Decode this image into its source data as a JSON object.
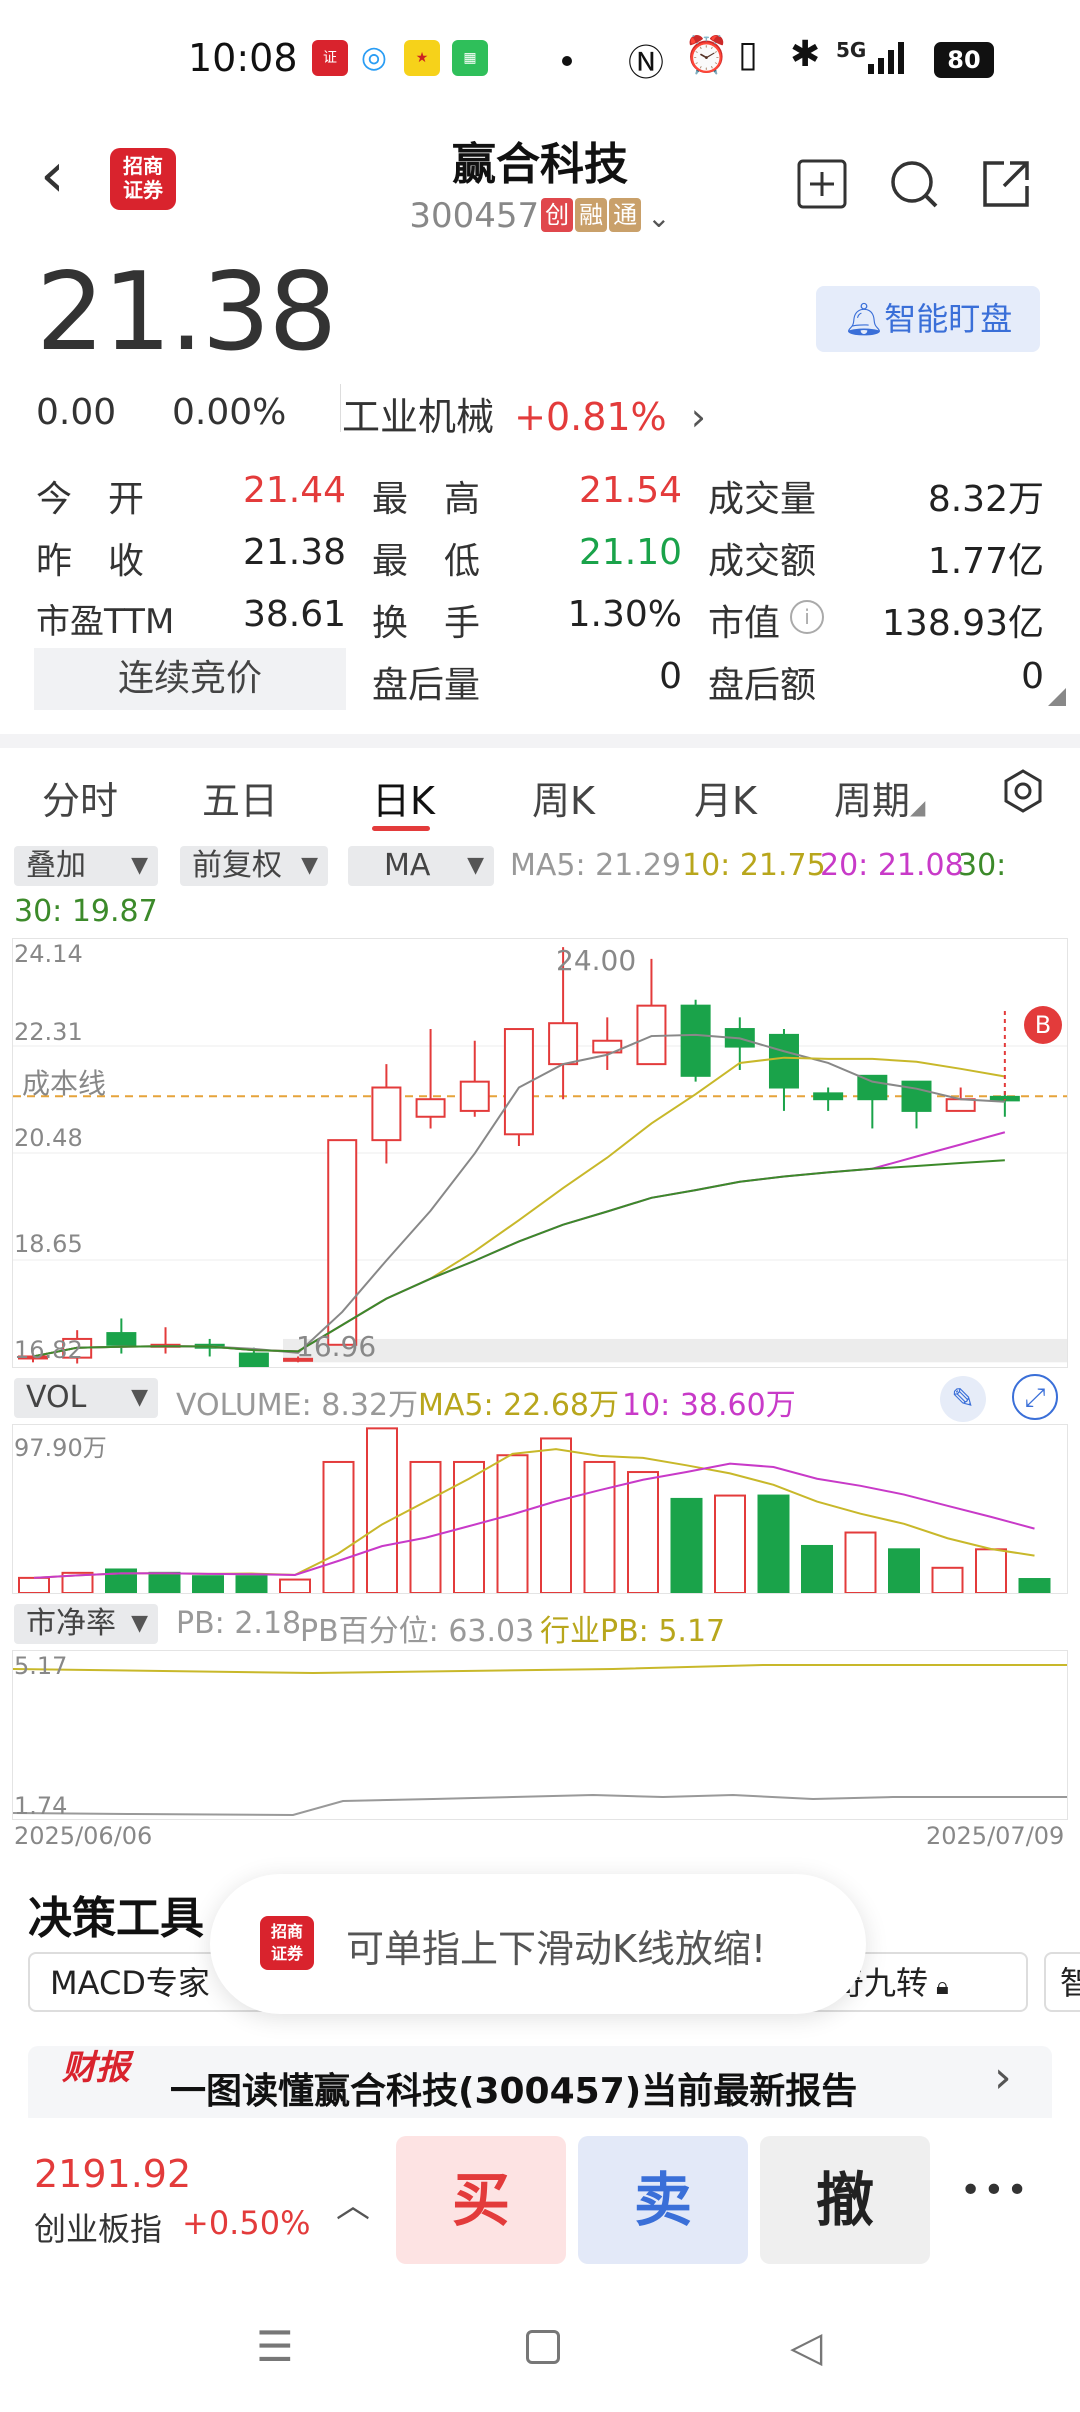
{
  "status_bar": {
    "time": "10:08",
    "battery": "80",
    "network": "5G"
  },
  "header": {
    "title": "赢合科技",
    "code": "300457",
    "tags": [
      {
        "text": "创",
        "color": "#e0474c"
      },
      {
        "text": "融",
        "color": "#c9a06a"
      },
      {
        "text": "通",
        "color": "#c9a06a"
      }
    ],
    "logo_line1": "招商",
    "logo_line2": "证券"
  },
  "quote": {
    "price": "21.38",
    "change": "0.00",
    "change_pct": "0.00%",
    "industry": "工业机械",
    "industry_pct": "+0.81%",
    "watch_button": "智能盯盘"
  },
  "stats": [
    {
      "label": "今　开",
      "value": "21.44",
      "color": "red"
    },
    {
      "label": "最　高",
      "value": "21.54",
      "color": "red"
    },
    {
      "label": "成交量",
      "value": "8.32万",
      "color": "plain"
    },
    {
      "label": "昨　收",
      "value": "21.38",
      "color": "plain"
    },
    {
      "label": "最　低",
      "value": "21.10",
      "color": "green"
    },
    {
      "label": "成交额",
      "value": "1.77亿",
      "color": "plain"
    },
    {
      "label": "市盈TTM",
      "value": "38.61",
      "color": "plain"
    },
    {
      "label": "换　手",
      "value": "1.30%",
      "color": "plain"
    },
    {
      "label": "市值",
      "value": "138.93亿",
      "color": "plain"
    },
    {
      "label": "盘后量",
      "value": "0",
      "color": "plain"
    },
    {
      "label": "盘后额",
      "value": "0",
      "color": "plain"
    }
  ],
  "auction_button": "连续竞价",
  "tabs": [
    "分时",
    "五日",
    "日K",
    "周K",
    "月K",
    "周期"
  ],
  "active_tab": "日K",
  "toolbar": {
    "overlay": "叠加",
    "adjust": "前复权",
    "indicator": "MA"
  },
  "ma_legend": {
    "ma5": "MA5: 21.29",
    "ma10": "10: 21.75",
    "ma20": "20: 21.08",
    "ma30": "30: 19.87"
  },
  "price_axis": [
    "24.14",
    "22.31",
    "20.48",
    "18.65",
    "16.82"
  ],
  "cost_line_label": "成本线",
  "high_annotation": "24.00",
  "low_annotation": "16.96",
  "buy_marker": "B",
  "volume_legend": {
    "selector": "VOL",
    "volume": "VOLUME: 8.32万",
    "ma5": "MA5: 22.68万",
    "ma10": "10: 38.60万"
  },
  "volume_axis": "97.90万",
  "pb_legend": {
    "selector": "市净率",
    "pb": "PB: 2.18",
    "pb_pct": "PB百分位: 63.03",
    "industry_pb": "行业PB: 5.17"
  },
  "pb_axis": [
    "5.17",
    "1.74"
  ],
  "dates": {
    "start": "2025/06/06",
    "end": "2025/07/09"
  },
  "colors": {
    "up": "#e33b3b",
    "down": "#1aa34a",
    "ma5": "#888888",
    "ma10": "#c8b82a",
    "ma20": "#c83ac8",
    "ma30": "#3c8a2a"
  },
  "chart_data": {
    "type": "candlestick",
    "candles": [
      {
        "o": 17.0,
        "c": 17.0,
        "h": 17.05,
        "l": 16.9
      },
      {
        "o": 16.98,
        "c": 17.3,
        "h": 17.45,
        "l": 16.88
      },
      {
        "o": 17.4,
        "c": 17.2,
        "h": 17.65,
        "l": 17.05
      },
      {
        "o": 17.2,
        "c": 17.2,
        "h": 17.5,
        "l": 17.05
      },
      {
        "o": 17.2,
        "c": 17.15,
        "h": 17.3,
        "l": 17.0
      },
      {
        "o": 17.05,
        "c": 16.8,
        "h": 17.15,
        "l": 16.75
      },
      {
        "o": 16.96,
        "c": 16.96,
        "h": 17.0,
        "l": 16.9
      },
      {
        "o": 17.2,
        "c": 20.7,
        "h": 20.7,
        "l": 17.2
      },
      {
        "o": 20.7,
        "c": 21.6,
        "h": 22.0,
        "l": 20.3
      },
      {
        "o": 21.1,
        "c": 21.4,
        "h": 22.6,
        "l": 20.9
      },
      {
        "o": 21.2,
        "c": 21.7,
        "h": 22.4,
        "l": 21.1
      },
      {
        "o": 20.8,
        "c": 22.6,
        "h": 22.6,
        "l": 20.6
      },
      {
        "o": 22.0,
        "c": 22.7,
        "h": 24.0,
        "l": 21.4
      },
      {
        "o": 22.2,
        "c": 22.4,
        "h": 22.8,
        "l": 21.9
      },
      {
        "o": 22.0,
        "c": 23.0,
        "h": 23.8,
        "l": 22.0
      },
      {
        "o": 23.0,
        "c": 21.8,
        "h": 23.1,
        "l": 21.7
      },
      {
        "o": 22.6,
        "c": 22.3,
        "h": 22.8,
        "l": 21.9
      },
      {
        "o": 22.5,
        "c": 21.6,
        "h": 22.6,
        "l": 21.2
      },
      {
        "o": 21.5,
        "c": 21.4,
        "h": 21.6,
        "l": 21.2
      },
      {
        "o": 21.8,
        "c": 21.4,
        "h": 21.8,
        "l": 20.9
      },
      {
        "o": 21.7,
        "c": 21.2,
        "h": 21.7,
        "l": 20.9
      },
      {
        "o": 21.2,
        "c": 21.4,
        "h": 21.6,
        "l": 21.2
      },
      {
        "o": 21.44,
        "c": 21.38,
        "h": 21.54,
        "l": 21.1
      }
    ],
    "volume": [
      9,
      12,
      14,
      12,
      10,
      10,
      8,
      78,
      98,
      78,
      78,
      82,
      92,
      78,
      72,
      56,
      58,
      58,
      28,
      36,
      26,
      15,
      26,
      8.32
    ],
    "volume_up": [
      true,
      true,
      false,
      false,
      false,
      false,
      true,
      true,
      true,
      true,
      true,
      true,
      true,
      true,
      true,
      false,
      true,
      false,
      false,
      true,
      false,
      true,
      true,
      false
    ],
    "ylim": [
      16.82,
      24.14
    ]
  },
  "toast": "可单指上下滑动K线放缩!",
  "decision": {
    "title": "决策工具",
    "chips": [
      "MACD专家",
      "神奇九转",
      "智"
    ]
  },
  "report": {
    "badge": "财报",
    "text": "一图读懂赢合科技(300457)当前最新报告"
  },
  "index": {
    "value": "2191.92",
    "name": "创业板指",
    "pct": "+0.50%"
  },
  "actions": {
    "buy": "买",
    "sell": "卖",
    "cancel": "撤",
    "more": "•••"
  }
}
